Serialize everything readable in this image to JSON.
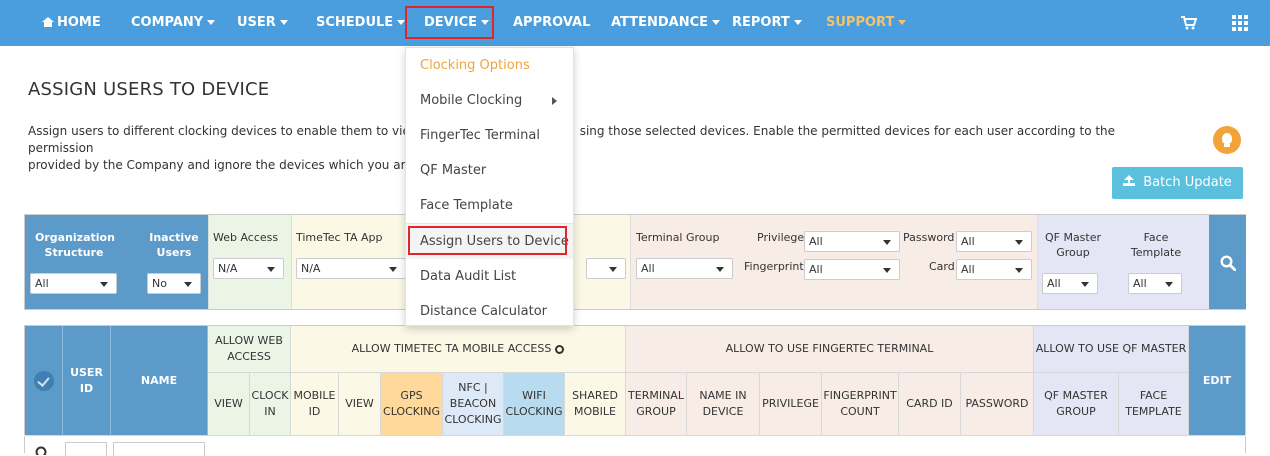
{
  "nav": {
    "home": "HOME",
    "company": "COMPANY",
    "user": "USER",
    "schedule": "SCHEDULE",
    "device": "DEVICE",
    "approval": "APPROVAL",
    "attendance": "ATTENDANCE",
    "report": "REPORT",
    "support": "SUPPORT",
    "support_color": "#f6c26a"
  },
  "page": {
    "title": "ASSIGN USERS TO DEVICE",
    "description_line1": "Assign users to different clocking devices to enable them to view",
    "description_line1b": "sing those selected devices. Enable the permitted devices for each user according to the permission",
    "description_line2": "provided by the Company and ignore the devices which you are n",
    "batch_update": "Batch Update"
  },
  "device_menu": {
    "items": [
      "Clocking Options",
      "Mobile Clocking",
      "FingerTec Terminal",
      "QF Master",
      "Face Template",
      "Assign Users to Device",
      "Data Audit List",
      "Distance Calculator"
    ],
    "selected": "Assign Users to Device"
  },
  "filters": {
    "org_structure_label": "Organization Structure",
    "org_structure_value": "All",
    "inactive_users_label": "Inactive Users",
    "inactive_users_value": "No",
    "web_access_label": "Web Access",
    "web_access_value": "N/A",
    "timetec_app_label": "TimeTec TA App",
    "timetec_app_value": "N/A",
    "terminal_group_label": "Terminal Group",
    "terminal_group_value": "All",
    "privilege_label": "Privilege",
    "privilege_value": "All",
    "fingerprint_label": "Fingerprint",
    "fingerprint_value": "All",
    "password_label": "Password",
    "password_value": "All",
    "card_label": "Card",
    "card_value": "All",
    "qf_master_group_label": "QF Master Group",
    "qf_master_group_value": "All",
    "face_template_label": "Face Template",
    "face_template_value": "All"
  },
  "grid": {
    "user_id": "USER ID",
    "name": "NAME",
    "allow_web_access": "ALLOW WEB ACCESS",
    "allow_timetec": "ALLOW TIMETEC TA MOBILE ACCESS",
    "allow_fingertec": "ALLOW TO USE FINGERTEC TERMINAL",
    "allow_qf": "ALLOW TO USE QF MASTER",
    "edit": "EDIT",
    "view": "VIEW",
    "clock_in": "CLOCK IN",
    "mobile_id": "MOBILE ID",
    "view2": "VIEW",
    "gps_clocking": "GPS CLOCKING",
    "nfc_beacon": "NFC | BEACON CLOCKING",
    "wifi_clocking": "WIFI CLOCKING",
    "shared_mobile": "SHARED MOBILE",
    "terminal_group": "TERMINAL GROUP",
    "name_in_device": "NAME IN DEVICE",
    "privilege": "PRIVILEGE",
    "fingerprint_count": "FINGERPRINT COUNT",
    "card_id": "CARD ID",
    "password": "PASSWORD",
    "qf_master_group": "QF MASTER GROUP",
    "face_template": "FACE TEMPLATE"
  }
}
